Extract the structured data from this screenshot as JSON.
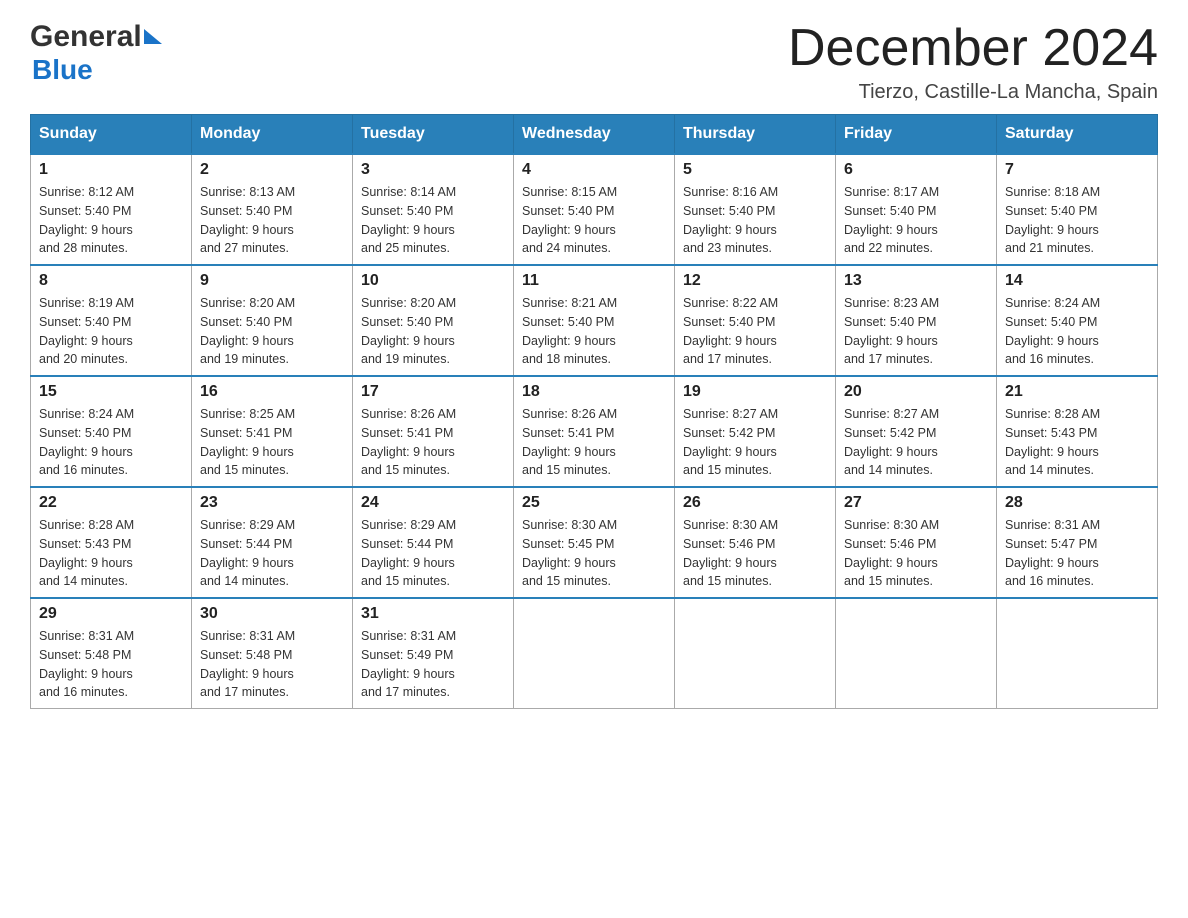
{
  "header": {
    "logo_general": "General",
    "logo_blue": "Blue",
    "month_title": "December 2024",
    "location": "Tierzo, Castille-La Mancha, Spain"
  },
  "days_of_week": [
    "Sunday",
    "Monday",
    "Tuesday",
    "Wednesday",
    "Thursday",
    "Friday",
    "Saturday"
  ],
  "weeks": [
    [
      {
        "day": "1",
        "sunrise": "8:12 AM",
        "sunset": "5:40 PM",
        "daylight": "9 hours and 28 minutes."
      },
      {
        "day": "2",
        "sunrise": "8:13 AM",
        "sunset": "5:40 PM",
        "daylight": "9 hours and 27 minutes."
      },
      {
        "day": "3",
        "sunrise": "8:14 AM",
        "sunset": "5:40 PM",
        "daylight": "9 hours and 25 minutes."
      },
      {
        "day": "4",
        "sunrise": "8:15 AM",
        "sunset": "5:40 PM",
        "daylight": "9 hours and 24 minutes."
      },
      {
        "day": "5",
        "sunrise": "8:16 AM",
        "sunset": "5:40 PM",
        "daylight": "9 hours and 23 minutes."
      },
      {
        "day": "6",
        "sunrise": "8:17 AM",
        "sunset": "5:40 PM",
        "daylight": "9 hours and 22 minutes."
      },
      {
        "day": "7",
        "sunrise": "8:18 AM",
        "sunset": "5:40 PM",
        "daylight": "9 hours and 21 minutes."
      }
    ],
    [
      {
        "day": "8",
        "sunrise": "8:19 AM",
        "sunset": "5:40 PM",
        "daylight": "9 hours and 20 minutes."
      },
      {
        "day": "9",
        "sunrise": "8:20 AM",
        "sunset": "5:40 PM",
        "daylight": "9 hours and 19 minutes."
      },
      {
        "day": "10",
        "sunrise": "8:20 AM",
        "sunset": "5:40 PM",
        "daylight": "9 hours and 19 minutes."
      },
      {
        "day": "11",
        "sunrise": "8:21 AM",
        "sunset": "5:40 PM",
        "daylight": "9 hours and 18 minutes."
      },
      {
        "day": "12",
        "sunrise": "8:22 AM",
        "sunset": "5:40 PM",
        "daylight": "9 hours and 17 minutes."
      },
      {
        "day": "13",
        "sunrise": "8:23 AM",
        "sunset": "5:40 PM",
        "daylight": "9 hours and 17 minutes."
      },
      {
        "day": "14",
        "sunrise": "8:24 AM",
        "sunset": "5:40 PM",
        "daylight": "9 hours and 16 minutes."
      }
    ],
    [
      {
        "day": "15",
        "sunrise": "8:24 AM",
        "sunset": "5:40 PM",
        "daylight": "9 hours and 16 minutes."
      },
      {
        "day": "16",
        "sunrise": "8:25 AM",
        "sunset": "5:41 PM",
        "daylight": "9 hours and 15 minutes."
      },
      {
        "day": "17",
        "sunrise": "8:26 AM",
        "sunset": "5:41 PM",
        "daylight": "9 hours and 15 minutes."
      },
      {
        "day": "18",
        "sunrise": "8:26 AM",
        "sunset": "5:41 PM",
        "daylight": "9 hours and 15 minutes."
      },
      {
        "day": "19",
        "sunrise": "8:27 AM",
        "sunset": "5:42 PM",
        "daylight": "9 hours and 15 minutes."
      },
      {
        "day": "20",
        "sunrise": "8:27 AM",
        "sunset": "5:42 PM",
        "daylight": "9 hours and 14 minutes."
      },
      {
        "day": "21",
        "sunrise": "8:28 AM",
        "sunset": "5:43 PM",
        "daylight": "9 hours and 14 minutes."
      }
    ],
    [
      {
        "day": "22",
        "sunrise": "8:28 AM",
        "sunset": "5:43 PM",
        "daylight": "9 hours and 14 minutes."
      },
      {
        "day": "23",
        "sunrise": "8:29 AM",
        "sunset": "5:44 PM",
        "daylight": "9 hours and 14 minutes."
      },
      {
        "day": "24",
        "sunrise": "8:29 AM",
        "sunset": "5:44 PM",
        "daylight": "9 hours and 15 minutes."
      },
      {
        "day": "25",
        "sunrise": "8:30 AM",
        "sunset": "5:45 PM",
        "daylight": "9 hours and 15 minutes."
      },
      {
        "day": "26",
        "sunrise": "8:30 AM",
        "sunset": "5:46 PM",
        "daylight": "9 hours and 15 minutes."
      },
      {
        "day": "27",
        "sunrise": "8:30 AM",
        "sunset": "5:46 PM",
        "daylight": "9 hours and 15 minutes."
      },
      {
        "day": "28",
        "sunrise": "8:31 AM",
        "sunset": "5:47 PM",
        "daylight": "9 hours and 16 minutes."
      }
    ],
    [
      {
        "day": "29",
        "sunrise": "8:31 AM",
        "sunset": "5:48 PM",
        "daylight": "9 hours and 16 minutes."
      },
      {
        "day": "30",
        "sunrise": "8:31 AM",
        "sunset": "5:48 PM",
        "daylight": "9 hours and 17 minutes."
      },
      {
        "day": "31",
        "sunrise": "8:31 AM",
        "sunset": "5:49 PM",
        "daylight": "9 hours and 17 minutes."
      },
      null,
      null,
      null,
      null
    ]
  ],
  "sunrise_label": "Sunrise:",
  "sunset_label": "Sunset:",
  "daylight_label": "Daylight:"
}
